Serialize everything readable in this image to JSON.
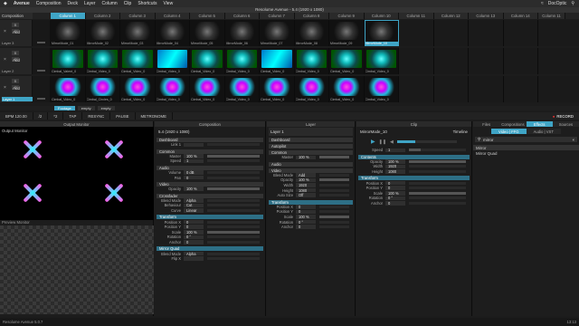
{
  "menubar": {
    "app_name": "Avenue",
    "menus": [
      "Composition",
      "Deck",
      "Layer",
      "Column",
      "Clip",
      "Shortcuts",
      "View"
    ],
    "window_title": "Resolume Avenue - 5.4 (1920 x 1080)",
    "brand": "DocOptic"
  },
  "columns": {
    "composition_label": "Composition",
    "items": [
      "Column 1",
      "Column 2",
      "Column 3",
      "Column 4",
      "Column 5",
      "Column 6",
      "Column 7",
      "Column 8",
      "Column 9",
      "Column 10",
      "Column 11",
      "Column 12",
      "Column 13",
      "Column 14",
      "Column 11",
      "Column 11"
    ]
  },
  "layers": [
    {
      "name": "Layer 3",
      "clips": [
        "MirrorMode_01",
        "MirrorMode_02",
        "MirrorMode_03",
        "MirrorMode_04",
        "MirrorMode_05",
        "MirrorMode_06",
        "MirrorMode_07",
        "MirrorMode_08",
        "MirrorMode_09",
        "MirrorMode_10"
      ],
      "style": "dark"
    },
    {
      "name": "Layer 2",
      "clips": [
        "Cimbal_Valent_0",
        "Cimbal_Video_0",
        "Cimbal_Video_0",
        "Cimbal_Video_0",
        "Cimbal_Video_0",
        "Cimbal_Video_0",
        "Cimbal_Video_0",
        "Cimbal_Video_0",
        "Cimbal_Video_0",
        "Cimbal_Video_0"
      ],
      "style": "cyan"
    },
    {
      "name": "Layer 1",
      "clips": [
        "Cimbal_Video_0",
        "Cimbal_Circles_0",
        "Cimbal_Video_0",
        "Cimbal_Video_0",
        "Cimbal_Video_0",
        "Cimbal_Video_0",
        "Cimbal_Video_0",
        "Cimbal_Video_0",
        "Cimbal_Video_0",
        "Cimbal_Video_0"
      ],
      "style": "mag"
    }
  ],
  "layer_controls": {
    "b": "B",
    "s": "S",
    "add": "Add",
    "close": "×"
  },
  "footer_row": {
    "deck_label": "Footage",
    "dropdowns": [
      "empty",
      "empty"
    ]
  },
  "transport": {
    "bpm_label": "BPM",
    "bpm": "120.00",
    "items": [
      "/2",
      "*2",
      "TAP",
      "RESYNC",
      "PAUSE",
      "METRONOME"
    ],
    "record_label": "RECORD"
  },
  "output": {
    "title": "Output Monitor",
    "output_label": "Output Monitor",
    "preview_label": "Preview Monitor"
  },
  "composition_panel": {
    "title": "Composition",
    "name": "5.4 (1920 x 1080)",
    "sections": [
      {
        "header": "Dashboard",
        "rows": [
          {
            "k": "Link 1",
            "v": ""
          }
        ]
      },
      {
        "header": "Common",
        "rows": [
          {
            "k": "Master",
            "v": "100 %"
          },
          {
            "k": "Speed",
            "v": "1"
          }
        ]
      },
      {
        "header": "Audio",
        "rows": [
          {
            "k": "Volume",
            "v": "0 dB"
          },
          {
            "k": "Pan",
            "v": "0"
          }
        ]
      },
      {
        "header": "Video",
        "rows": [
          {
            "k": "Opacity",
            "v": "100 %"
          }
        ]
      },
      {
        "header": "Crossfader",
        "rows": [
          {
            "k": "Blend Mode",
            "v": "Alpha"
          },
          {
            "k": "Behaviour",
            "v": "Cut"
          },
          {
            "k": "Curve",
            "v": "Linear"
          }
        ]
      },
      {
        "header": "Transform",
        "rows": [
          {
            "k": "Position X",
            "v": "0"
          },
          {
            "k": "Position Y",
            "v": "0"
          },
          {
            "k": "Scale",
            "v": "100 %"
          },
          {
            "k": "Rotation",
            "v": "0 °"
          },
          {
            "k": "Anchor",
            "v": "0"
          }
        ]
      },
      {
        "header": "Mirror Quad",
        "rows": [
          {
            "k": "Blend Mode",
            "v": "Alpha"
          },
          {
            "k": "Flip X",
            "v": ""
          }
        ]
      }
    ]
  },
  "layer_panel": {
    "title": "Layer",
    "name": "Layer 1",
    "sections": [
      {
        "header": "Dashboard",
        "rows": []
      },
      {
        "header": "Autopilot",
        "rows": []
      },
      {
        "header": "Common",
        "rows": [
          {
            "k": "Master",
            "v": "100 %"
          }
        ]
      },
      {
        "header": "Audio",
        "rows": []
      },
      {
        "header": "Video",
        "rows": [
          {
            "k": "Blend Mode",
            "v": "Add"
          },
          {
            "k": "Opacity",
            "v": "100 %"
          },
          {
            "k": "Width",
            "v": "1920"
          },
          {
            "k": "Height",
            "v": "1080"
          },
          {
            "k": "Auto Size",
            "v": "Off"
          }
        ]
      },
      {
        "header": "Transform",
        "rows": [
          {
            "k": "Position X",
            "v": "0"
          },
          {
            "k": "Position Y",
            "v": "0"
          },
          {
            "k": "Scale",
            "v": "100 %"
          },
          {
            "k": "Rotation",
            "v": "0 °"
          },
          {
            "k": "Anchor",
            "v": "0"
          }
        ]
      }
    ]
  },
  "clip_panel": {
    "title": "Clip",
    "name": "MirrorMode_10",
    "timeline": "Timeline",
    "speed_label": "Speed",
    "speed": "1",
    "sections": [
      {
        "header": "Contents",
        "rows": [
          {
            "k": "Opacity",
            "v": "100 %"
          },
          {
            "k": "Width",
            "v": "1920"
          },
          {
            "k": "Height",
            "v": "1080"
          }
        ]
      },
      {
        "header": "Transform",
        "rows": [
          {
            "k": "Position X",
            "v": "0"
          },
          {
            "k": "Position Y",
            "v": "0"
          },
          {
            "k": "Scale",
            "v": "100 %"
          },
          {
            "k": "Rotation",
            "v": "0 °"
          },
          {
            "k": "Anchor",
            "v": "0"
          }
        ]
      }
    ],
    "content_name": "MirrorMode_10.mov"
  },
  "browser": {
    "tabs": [
      "Files",
      "Compositions",
      "Effects",
      "Sources"
    ],
    "subtabs": [
      "Video | FFG",
      "Audio | VST"
    ],
    "search_value": "mirror",
    "results": [
      "Mirror",
      "Mirror Quad"
    ]
  },
  "status": {
    "left": "Resolume Avenue 5.0.7",
    "right": "13:13"
  }
}
